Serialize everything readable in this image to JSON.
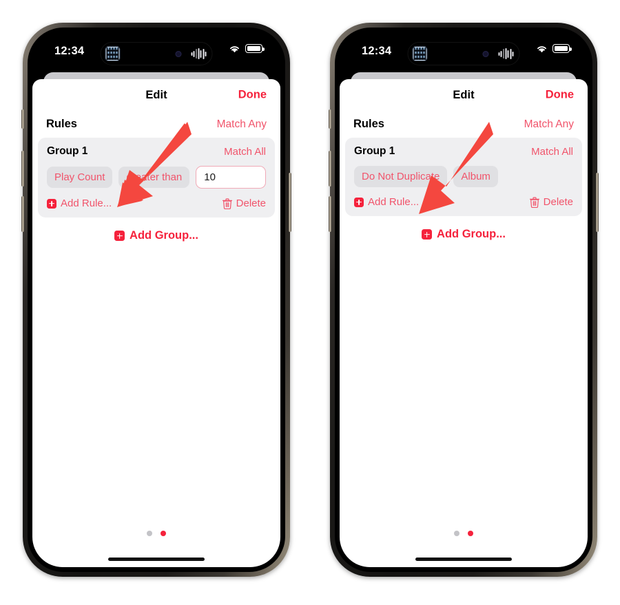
{
  "colors": {
    "accent_red": "#f5223c",
    "pill_text_red": "#f1546b",
    "pill_bg": "#e0e0e3",
    "group_bg": "#efeff1",
    "input_border": "#f0a9b6",
    "dot_inactive": "#c3c3c7",
    "arrow": "#f4473f"
  },
  "phones": [
    {
      "status_bar": {
        "time": "12:34",
        "island_app_icon": "app-thumbnail-icon",
        "island_camera_icon": "front-camera-icon",
        "island_audio_icon": "audio-waveform-icon",
        "wifi_icon": "wifi-icon",
        "battery_icon": "battery-full-icon"
      },
      "nav": {
        "title": "Edit",
        "done_label": "Done"
      },
      "rules": {
        "section_title": "Rules",
        "match_label": "Match Any"
      },
      "group": {
        "name": "Group 1",
        "match_label": "Match All",
        "rule": {
          "field_pill": "Play Count",
          "operator_pill": "greater than",
          "value": "10",
          "value_placeholder": "",
          "has_value_input": true
        },
        "add_rule_label": "Add Rule...",
        "delete_label": "Delete"
      },
      "add_group_label": "Add Group...",
      "page_dots": {
        "count": 2,
        "active_index": 1
      }
    },
    {
      "status_bar": {
        "time": "12:34",
        "island_app_icon": "app-thumbnail-icon",
        "island_camera_icon": "front-camera-icon",
        "island_audio_icon": "audio-waveform-icon",
        "wifi_icon": "wifi-icon",
        "battery_icon": "battery-full-icon"
      },
      "nav": {
        "title": "Edit",
        "done_label": "Done"
      },
      "rules": {
        "section_title": "Rules",
        "match_label": "Match Any"
      },
      "group": {
        "name": "Group 1",
        "match_label": "Match All",
        "rule": {
          "field_pill": "Do Not Duplicate",
          "operator_pill": "Album",
          "value": "",
          "value_placeholder": "",
          "has_value_input": false
        },
        "add_rule_label": "Add Rule...",
        "delete_label": "Delete"
      },
      "add_group_label": "Add Group...",
      "page_dots": {
        "count": 2,
        "active_index": 1
      }
    }
  ],
  "annotations": [
    {
      "name": "arrow-pointing-to-play-count-pill",
      "icon": "arrow-down-left-icon"
    },
    {
      "name": "arrow-pointing-to-do-not-duplicate-pill",
      "icon": "arrow-down-left-icon"
    }
  ]
}
